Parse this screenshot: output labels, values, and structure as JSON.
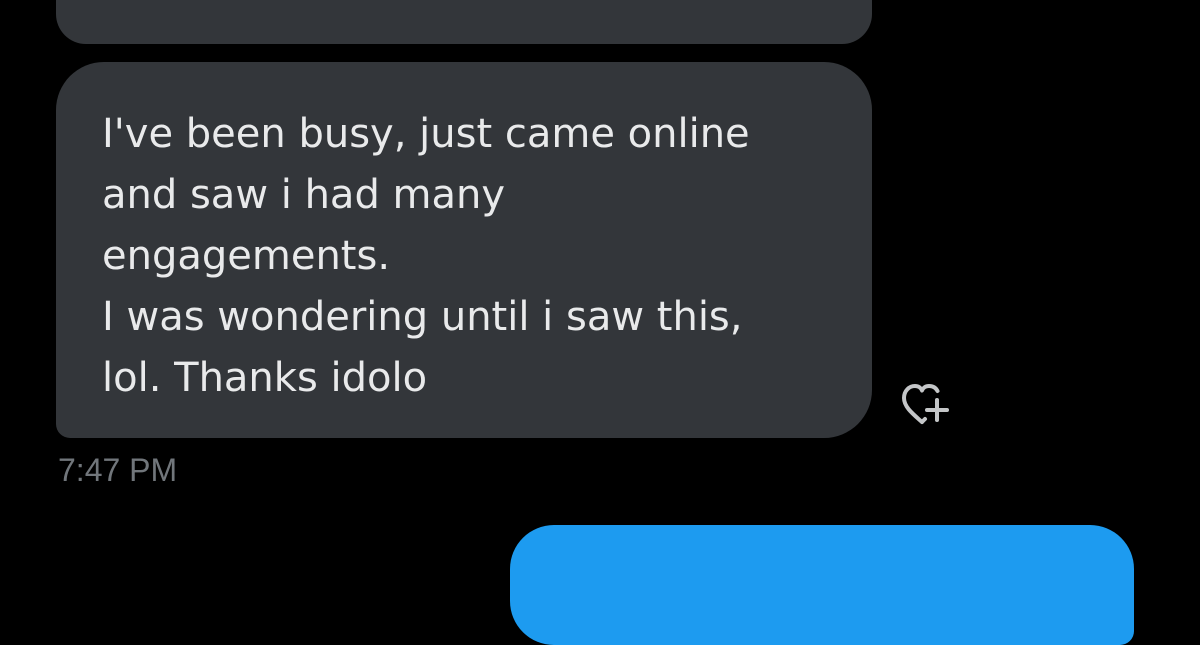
{
  "conversation": {
    "previous_message": {
      "text": ""
    },
    "received_message": {
      "lines": [
        "I've been busy, just came online",
        "and saw i had many",
        "engagements.",
        "I was wondering until i saw this,",
        "lol. Thanks idolo"
      ],
      "timestamp": "7:47 PM",
      "reaction_icon": "add-reaction-heart-icon"
    },
    "next_message": {
      "text": ""
    }
  },
  "colors": {
    "background": "#000000",
    "received_bubble": "#33363a",
    "sent_bubble": "#1d9bf0",
    "message_text": "#e9eaeb",
    "secondary_text": "#71767b",
    "icon": "#c4c6c8"
  }
}
